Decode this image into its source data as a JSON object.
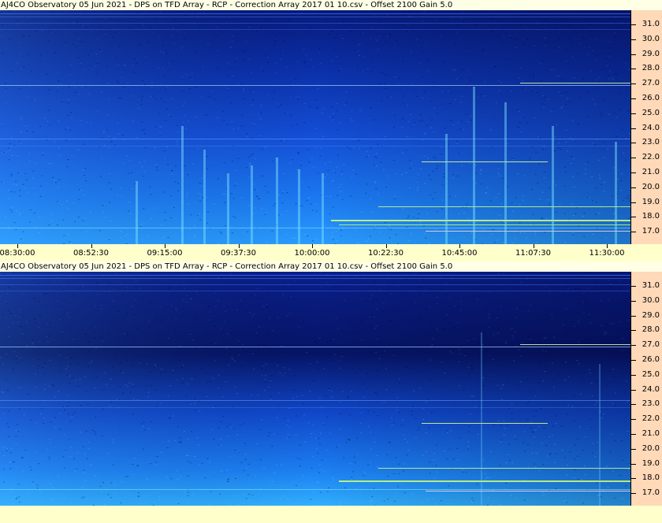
{
  "panels": [
    {
      "title": "AJ4CO Observatory 05 Jun 2021  -  DPS on TFD Array  -  RCP  -  Correction Array 2017 01 10.csv  -  Offset 2100  Gain 5.0",
      "freq_labels": [
        "31.0",
        "30.0",
        "29.0",
        "28.0",
        "27.0",
        "26.0",
        "25.0",
        "24.0",
        "23.0",
        "22.0",
        "21.0",
        "20.0",
        "19.0",
        "18.0",
        "17.0"
      ],
      "time_labels": [
        "08:30:00",
        "08:52:30",
        "09:15:00",
        "09:37:30",
        "10:00:00",
        "10:22:30",
        "10:45:00",
        "11:07:30",
        "11:30:00"
      ]
    },
    {
      "title": "AJ4CO Observatory 05 Jun 2021  -  DPS on TFD Array  -  RCP  -  Correction Array 2017 01 10.csv  -  Offset 2100  Gain 5.0",
      "freq_labels": [
        "31.0",
        "30.0",
        "29.0",
        "28.0",
        "27.0",
        "26.0",
        "25.0",
        "24.0",
        "23.0",
        "22.0",
        "21.0",
        "20.0",
        "19.0",
        "18.0",
        "17.0"
      ],
      "time_labels": []
    }
  ],
  "colors": {
    "background": "#ffffe6",
    "freq_axis": "#ffd9b8",
    "spectrogram_dark": "#05145a",
    "spectrogram_bright": "#1e9cff"
  }
}
